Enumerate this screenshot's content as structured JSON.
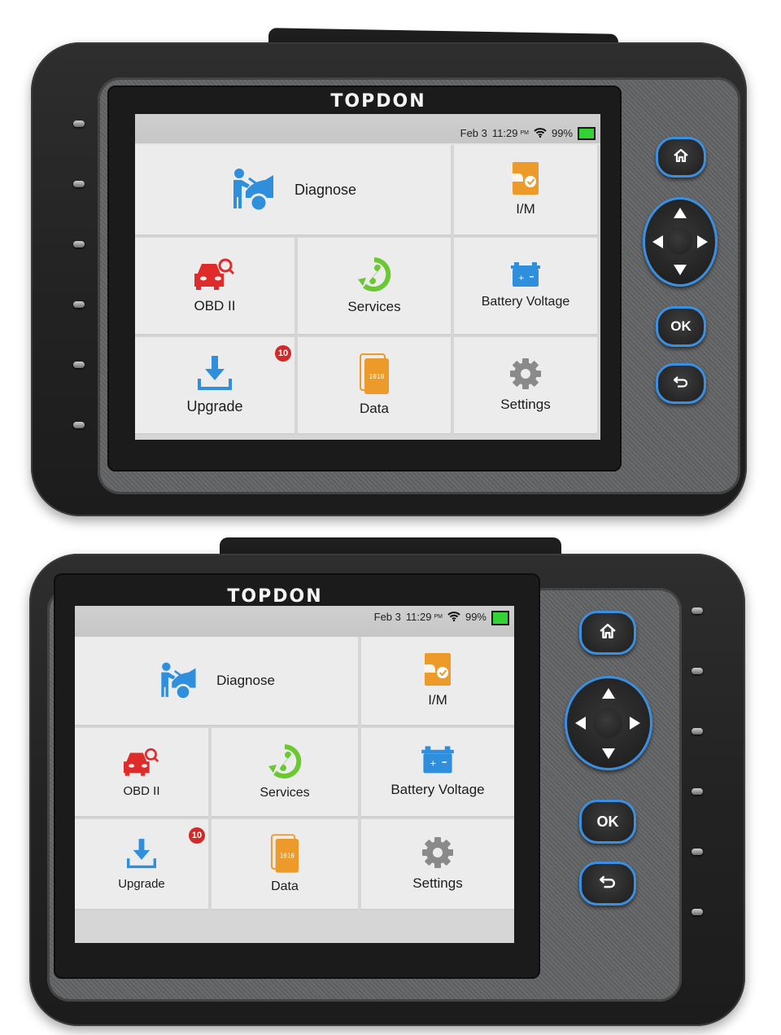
{
  "devices": [
    {
      "brand": "TOPDON",
      "status": {
        "date": "Feb 3",
        "time": "11:29",
        "ampm": "PM",
        "battery": "99%",
        "battery_level": 0.99,
        "wifi": "wifi-icon"
      },
      "tiles": [
        {
          "id": "diagnose",
          "label": "Diagnose",
          "icon": "mechanic-car-icon",
          "color": "#2f8fdc"
        },
        {
          "id": "im",
          "label": "I/M",
          "icon": "emission-check-icon",
          "color": "#ec9a2a"
        },
        {
          "id": "obd2",
          "label": "OBD II",
          "icon": "car-search-icon",
          "color": "#e02b2b"
        },
        {
          "id": "services",
          "label": "Services",
          "icon": "service-wrench-icon",
          "color": "#6cc832"
        },
        {
          "id": "battery",
          "label": "Battery Voltage",
          "icon": "battery-icon",
          "color": "#2f8fdc"
        },
        {
          "id": "upgrade",
          "label": "Upgrade",
          "icon": "download-icon",
          "color": "#2f8fdc",
          "badge": "10"
        },
        {
          "id": "data",
          "label": "Data",
          "icon": "binary-file-icon",
          "color": "#ec9a2a",
          "icon_text": "1010"
        },
        {
          "id": "settings",
          "label": "Settings",
          "icon": "gear-icon",
          "color": "#8a8a8a"
        }
      ],
      "buttons": {
        "home": "home-icon",
        "ok": "OK",
        "back": "back-icon"
      }
    },
    {
      "brand": "TOPDON",
      "status": {
        "date": "Feb 3",
        "time": "11:29",
        "ampm": "PM",
        "battery": "99%",
        "battery_level": 0.99,
        "wifi": "wifi-icon"
      },
      "tiles": [
        {
          "id": "diagnose",
          "label": "Diagnose",
          "icon": "mechanic-car-icon",
          "color": "#2f8fdc"
        },
        {
          "id": "im",
          "label": "I/M",
          "icon": "emission-check-icon",
          "color": "#ec9a2a"
        },
        {
          "id": "obd2",
          "label": "OBD II",
          "icon": "car-search-icon",
          "color": "#e02b2b"
        },
        {
          "id": "services",
          "label": "Services",
          "icon": "service-wrench-icon",
          "color": "#6cc832"
        },
        {
          "id": "battery",
          "label": "Battery Voltage",
          "icon": "battery-icon",
          "color": "#2f8fdc"
        },
        {
          "id": "upgrade",
          "label": "Upgrade",
          "icon": "download-icon",
          "color": "#2f8fdc",
          "badge": "10"
        },
        {
          "id": "data",
          "label": "Data",
          "icon": "binary-file-icon",
          "color": "#ec9a2a",
          "icon_text": "1010"
        },
        {
          "id": "settings",
          "label": "Settings",
          "icon": "gear-icon",
          "color": "#8a8a8a"
        }
      ],
      "buttons": {
        "home": "home-icon",
        "ok": "OK",
        "back": "back-icon"
      }
    }
  ],
  "colors": {
    "accent_blue": "#3b8fe0",
    "battery_green": "#35d235",
    "badge_red": "#d12a2a"
  }
}
